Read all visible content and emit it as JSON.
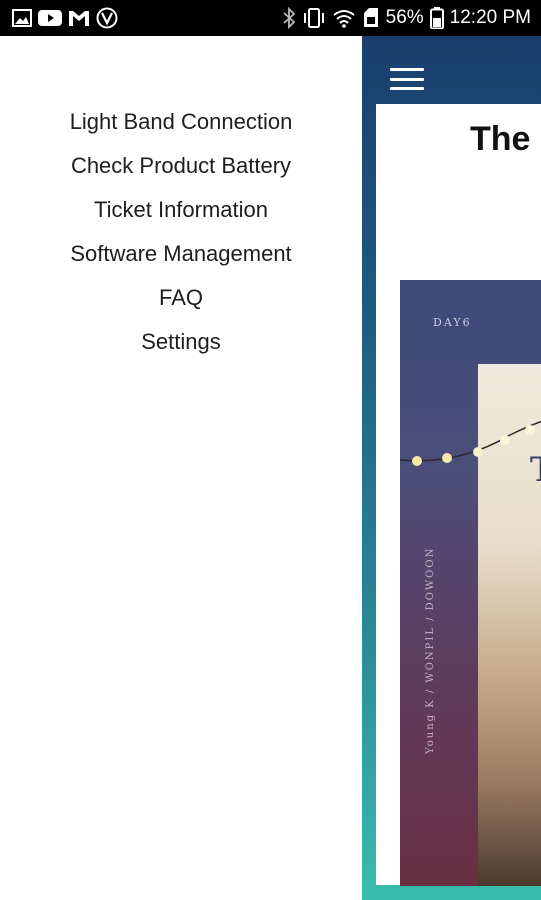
{
  "status_bar": {
    "battery_percent": "56%",
    "time": "12:20 PM",
    "left_icons": [
      "gallery-icon",
      "youtube-icon",
      "gmail-icon",
      "v-app-icon"
    ],
    "right_icons": [
      "bluetooth-icon",
      "vibrate-icon",
      "wifi-icon",
      "sim-icon",
      "battery-icon"
    ]
  },
  "drawer": {
    "items": [
      {
        "label": "Light Band Connection"
      },
      {
        "label": "Check Product Battery"
      },
      {
        "label": "Ticket Information"
      },
      {
        "label": "Software Management"
      },
      {
        "label": "FAQ"
      },
      {
        "label": "Settings"
      }
    ]
  },
  "background_app": {
    "heading_visible": "The",
    "album": {
      "corner_text": "DAY6",
      "side_text": "Young K / WONPIL / DOWOON",
      "title_letter": "T"
    }
  }
}
